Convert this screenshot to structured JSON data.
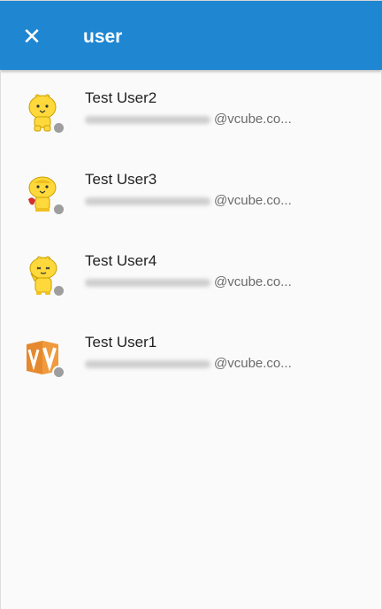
{
  "header": {
    "close_icon": "close-icon",
    "title": "user",
    "color": "#1f87d2"
  },
  "results": [
    {
      "name": "Test User2",
      "email_domain": "@vcube.co...",
      "avatar": "yellow-mascot-avatar",
      "status": "offline"
    },
    {
      "name": "Test User3",
      "email_domain": "@vcube.co...",
      "avatar": "yellow-mascot-avatar",
      "status": "offline"
    },
    {
      "name": "Test User4",
      "email_domain": "@vcube.co...",
      "avatar": "yellow-mascot-avatar",
      "status": "offline"
    },
    {
      "name": "Test User1",
      "email_domain": "@vcube.co...",
      "avatar": "vcube-logo-avatar",
      "status": "offline"
    }
  ]
}
